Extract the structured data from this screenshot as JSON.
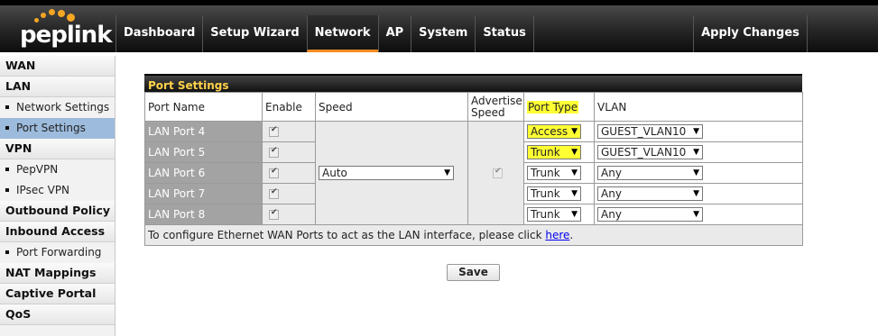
{
  "brand": {
    "logo_text": "peplink",
    "accent": "#f58a1f"
  },
  "nav": {
    "items": [
      {
        "label": "Dashboard",
        "active": false
      },
      {
        "label": "Setup Wizard",
        "active": false
      },
      {
        "label": "Network",
        "active": true
      },
      {
        "label": "AP",
        "active": false
      },
      {
        "label": "System",
        "active": false
      },
      {
        "label": "Status",
        "active": false
      }
    ],
    "apply_label": "Apply Changes"
  },
  "sidebar": {
    "wan": "WAN",
    "lan": "LAN",
    "network_settings": "Network Settings",
    "port_settings": "Port Settings",
    "vpn": "VPN",
    "pepvpn": "PepVPN",
    "ipsec_vpn": "IPsec VPN",
    "outbound_policy": "Outbound Policy",
    "inbound_access": "Inbound Access",
    "port_forwarding": "Port Forwarding",
    "nat_mappings": "NAT Mappings",
    "captive_portal": "Captive Portal",
    "qos": "QoS"
  },
  "port_settings": {
    "title": "Port Settings",
    "headers": {
      "port_name": "Port Name",
      "enable": "Enable",
      "speed": "Speed",
      "advertise_speed": "Advertise Speed",
      "port_type": "Port Type",
      "vlan": "VLAN"
    },
    "speed_value": "Auto",
    "rows": [
      {
        "name": "LAN Port 4",
        "enabled": true,
        "port_type": "Access",
        "vlan": "GUEST_VLAN10"
      },
      {
        "name": "LAN Port 5",
        "enabled": true,
        "port_type": "Trunk",
        "vlan": "GUEST_VLAN10"
      },
      {
        "name": "LAN Port 6",
        "enabled": true,
        "port_type": "Trunk",
        "vlan": "Any"
      },
      {
        "name": "LAN Port 7",
        "enabled": true,
        "port_type": "Trunk",
        "vlan": "Any"
      },
      {
        "name": "LAN Port 8",
        "enabled": true,
        "port_type": "Trunk",
        "vlan": "Any"
      }
    ],
    "note_text": "To configure Ethernet WAN Ports to act as the LAN interface, please click ",
    "note_link": "here",
    "note_end": "."
  },
  "save_label": "Save",
  "highlight_color": "#ffff33"
}
